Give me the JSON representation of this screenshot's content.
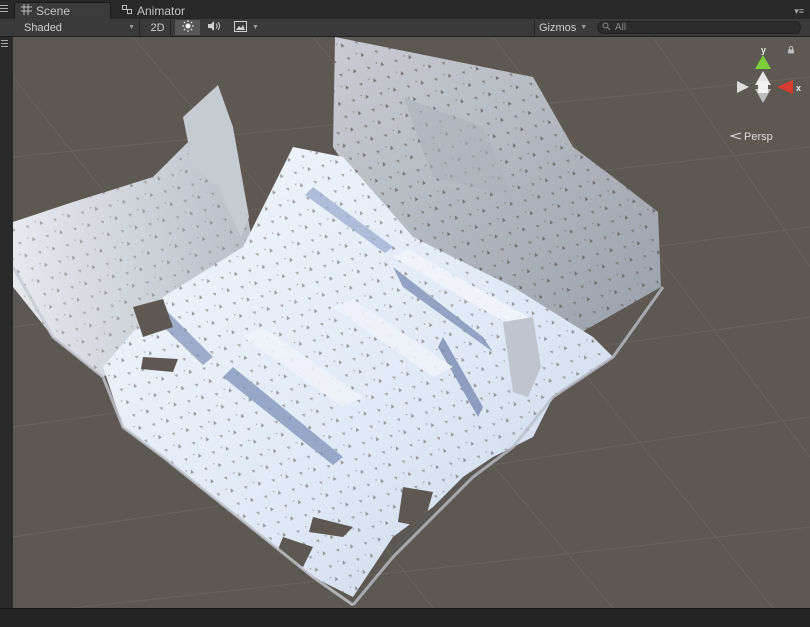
{
  "tabs": {
    "scene_label": "Scene",
    "scene_icon": "grid-icon",
    "animator_label": "Animator",
    "animator_icon": "animator-icon"
  },
  "toolbar": {
    "shading_mode": "Shaded",
    "mode_2d_label": "2D",
    "lighting_icon": "sun-icon",
    "audio_icon": "speaker-icon",
    "effects_icon": "image-icon",
    "gizmos_label": "Gizmos",
    "search_placeholder": "All"
  },
  "orientation_gizmo": {
    "y_label": "y",
    "x_label": "x",
    "projection_label": "Persp"
  },
  "colors": {
    "viewport_bg": "#5e5852",
    "x_axis": "#d63b2f",
    "y_axis": "#7ccf3b",
    "mesh_light": "#e8eef8",
    "mesh_shadow": "#8a9bbf"
  }
}
